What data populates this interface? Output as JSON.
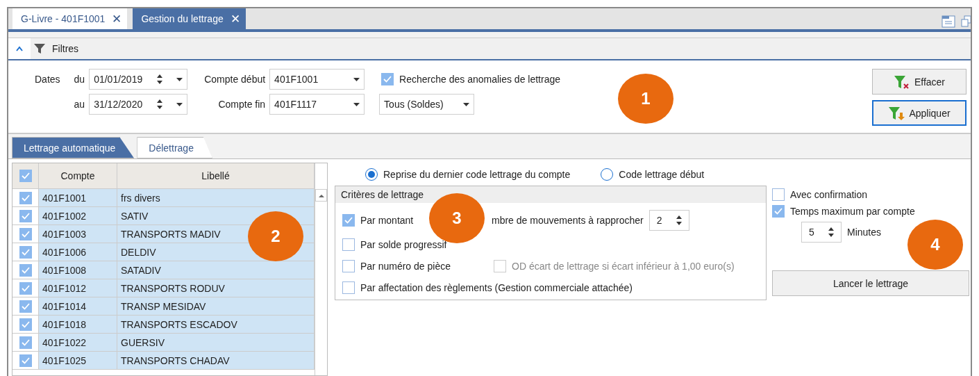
{
  "tabs": [
    {
      "label": "G-Livre - 401F1001",
      "selected": false,
      "close": "✕"
    },
    {
      "label": "Gestion du lettrage",
      "selected": true,
      "close": "✕"
    }
  ],
  "filters": {
    "title": "Filtres",
    "expanded": true,
    "dates_label": "Dates",
    "from_label": "du",
    "from_value": "01/01/2019",
    "to_label": "au",
    "to_value": "31/12/2020",
    "account_start_label": "Compte début",
    "account_start": "401F1001",
    "account_end_label": "Compte fin",
    "account_end": "401F1117",
    "anomalies": {
      "label": "Recherche des anomalies de lettrage",
      "checked": true
    },
    "balance_filter": "Tous (Soldes)",
    "buttons": [
      {
        "label": "Effacer",
        "kind": "clear",
        "focused": false
      },
      {
        "label": "Appliquer",
        "kind": "apply",
        "focused": true
      }
    ]
  },
  "subtabs": [
    {
      "label": "Lettrage automatique",
      "selected": true
    },
    {
      "label": "Délettrage",
      "selected": false
    }
  ],
  "table": {
    "all_checked": true,
    "columns": [
      "Compte",
      "Libellé"
    ],
    "rows": [
      {
        "checked": true,
        "account": "401F1001",
        "label": "frs divers"
      },
      {
        "checked": true,
        "account": "401F1002",
        "label": "SATIV"
      },
      {
        "checked": true,
        "account": "401F1003",
        "label": "TRANSPORTS MADIV"
      },
      {
        "checked": true,
        "account": "401F1006",
        "label": "DELDIV"
      },
      {
        "checked": true,
        "account": "401F1008",
        "label": "SATADIV"
      },
      {
        "checked": true,
        "account": "401F1012",
        "label": "TRANSPORTS RODUV"
      },
      {
        "checked": true,
        "account": "401F1014",
        "label": "TRANSP MESIDAV"
      },
      {
        "checked": true,
        "account": "401F1018",
        "label": "TRANSPORTS ESCADOV"
      },
      {
        "checked": true,
        "account": "401F1022",
        "label": "GUERSIV"
      },
      {
        "checked": true,
        "account": "401F1025",
        "label": "TRANSPORTS CHADAV"
      }
    ]
  },
  "code_options": [
    {
      "label": "Reprise du dernier code lettrage du compte",
      "selected": true
    },
    {
      "label": "Code lettrage début",
      "selected": false
    }
  ],
  "criteria": {
    "title": "Critères de lettrage",
    "by_amount": {
      "label": "Par montant",
      "checked": true
    },
    "moves_label": "mbre de mouvements à rapprocher",
    "moves_value": "2",
    "by_progressive": {
      "label": "Par solde progressif",
      "checked": false
    },
    "by_piece": {
      "label": "Par numéro de pièce",
      "checked": false
    },
    "od_gap": {
      "label": "OD écart de lettrage si écart inférieur à 1,00 euro(s)",
      "checked": false,
      "disabled": true
    },
    "by_payment": {
      "label": "Par affectation des règlements (Gestion commerciale attachée)",
      "checked": false
    }
  },
  "options": {
    "confirm": {
      "label": "Avec confirmation",
      "checked": false
    },
    "max_time": {
      "label": "Temps maximum par compte",
      "checked": true
    },
    "minutes_value": "5",
    "minutes_label": "Minutes",
    "run_button": "Lancer le lettrage"
  },
  "callouts": [
    "1",
    "2",
    "3",
    "4"
  ]
}
